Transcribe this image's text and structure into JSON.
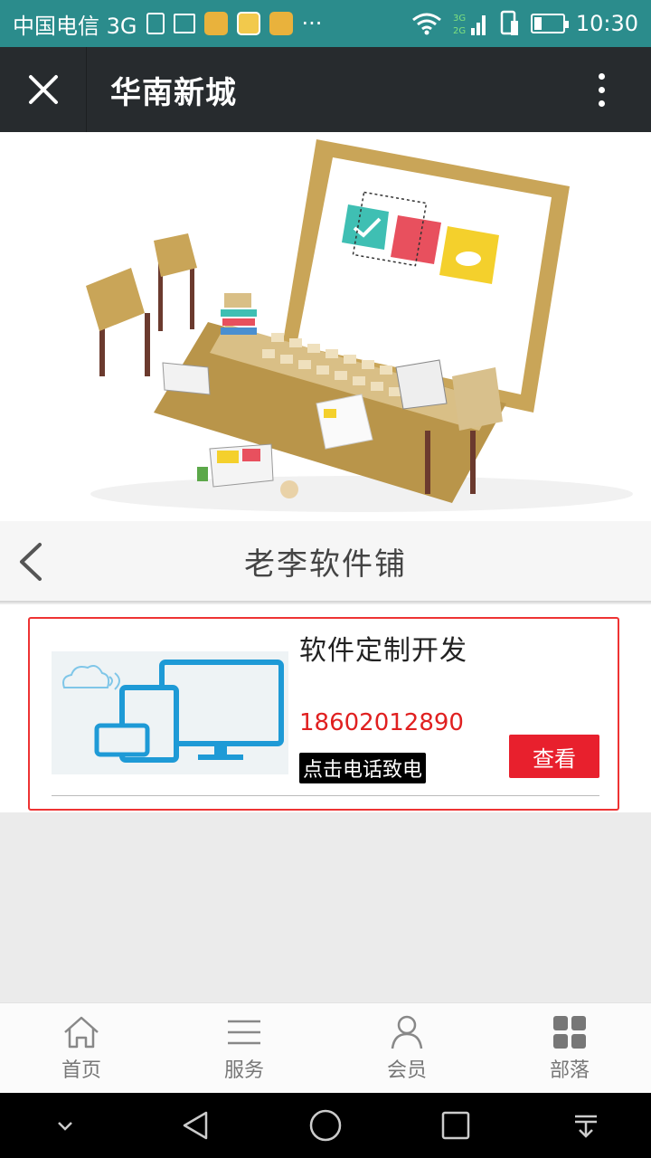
{
  "status_bar": {
    "carrier": "中国电信 3G",
    "more": "···",
    "time": "10:30",
    "icons": [
      "sim-icon",
      "picture-icon",
      "app-icon",
      "app-icon",
      "app-icon",
      "wifi-icon",
      "signal-icon",
      "battery-icon"
    ]
  },
  "app_bar": {
    "title": "华南新城"
  },
  "shop": {
    "name": "老李软件铺"
  },
  "product": {
    "title": "软件定制开发",
    "phone": "18602012890",
    "call_label": "点击电话致电",
    "view_label": "查看"
  },
  "bottom_nav": {
    "items": [
      {
        "label": "首页",
        "icon": "home-icon"
      },
      {
        "label": "服务",
        "icon": "list-icon"
      },
      {
        "label": "会员",
        "icon": "user-icon"
      },
      {
        "label": "部落",
        "icon": "grid-icon"
      }
    ]
  },
  "colors": {
    "status_bar": "#2b8c8c",
    "app_bar": "#272b2e",
    "accent_red": "#e8202d"
  }
}
